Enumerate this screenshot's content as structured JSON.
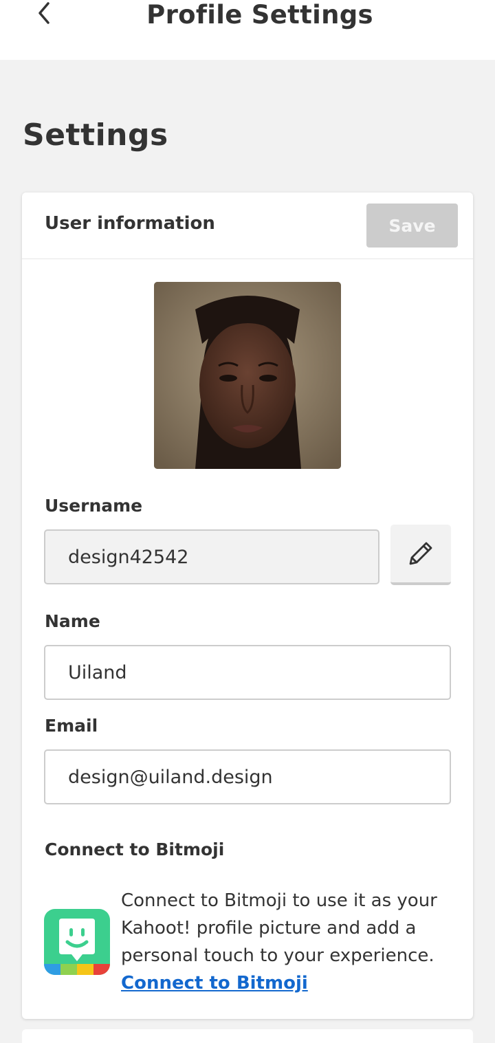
{
  "topbar": {
    "back_icon": "chevron-left-icon",
    "title": "Profile Settings"
  },
  "page": {
    "heading": "Settings"
  },
  "user_info": {
    "title": "User information",
    "save_label": "Save",
    "username_label": "Username",
    "username_value": "design42542",
    "edit_icon": "pencil-icon",
    "name_label": "Name",
    "name_value": "Uiland",
    "email_label": "Email",
    "email_value": "design@uiland.design"
  },
  "bitmoji": {
    "heading": "Connect to Bitmoji",
    "description": "Connect to Bitmoji to use it as your Kahoot! profile picture and add a personal touch to your experience.",
    "link_label": "Connect to Bitmoji",
    "logo_icon": "bitmoji-logo-icon"
  },
  "colors": {
    "link": "#1368ce",
    "save_disabled_bg": "#cccccc",
    "bitmoji_green": "#3ccf8e"
  }
}
